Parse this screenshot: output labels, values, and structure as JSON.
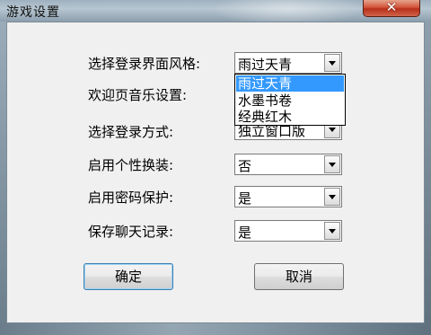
{
  "window": {
    "title": "游戏设置",
    "close_glyph": "✕"
  },
  "settings": [
    {
      "label": "选择登录界面风格:",
      "value": "雨过天青"
    },
    {
      "label": "欢迎页音乐设置:",
      "value": ""
    },
    {
      "label": "选择登录方式:",
      "value": "独立窗口版"
    },
    {
      "label": "启用个性换装:",
      "value": "否"
    },
    {
      "label": "启用密码保护:",
      "value": "是"
    },
    {
      "label": "保存聊天记录:",
      "value": "是"
    }
  ],
  "dropdown": {
    "options": [
      "雨过天青",
      "水墨书卷",
      "经典红木"
    ],
    "selected_index": 0,
    "highlight_color": "#3399ff"
  },
  "buttons": {
    "ok": "确定",
    "cancel": "取消"
  },
  "icons": {
    "combo_arrow": "chevron-down-icon",
    "close": "close-icon"
  }
}
